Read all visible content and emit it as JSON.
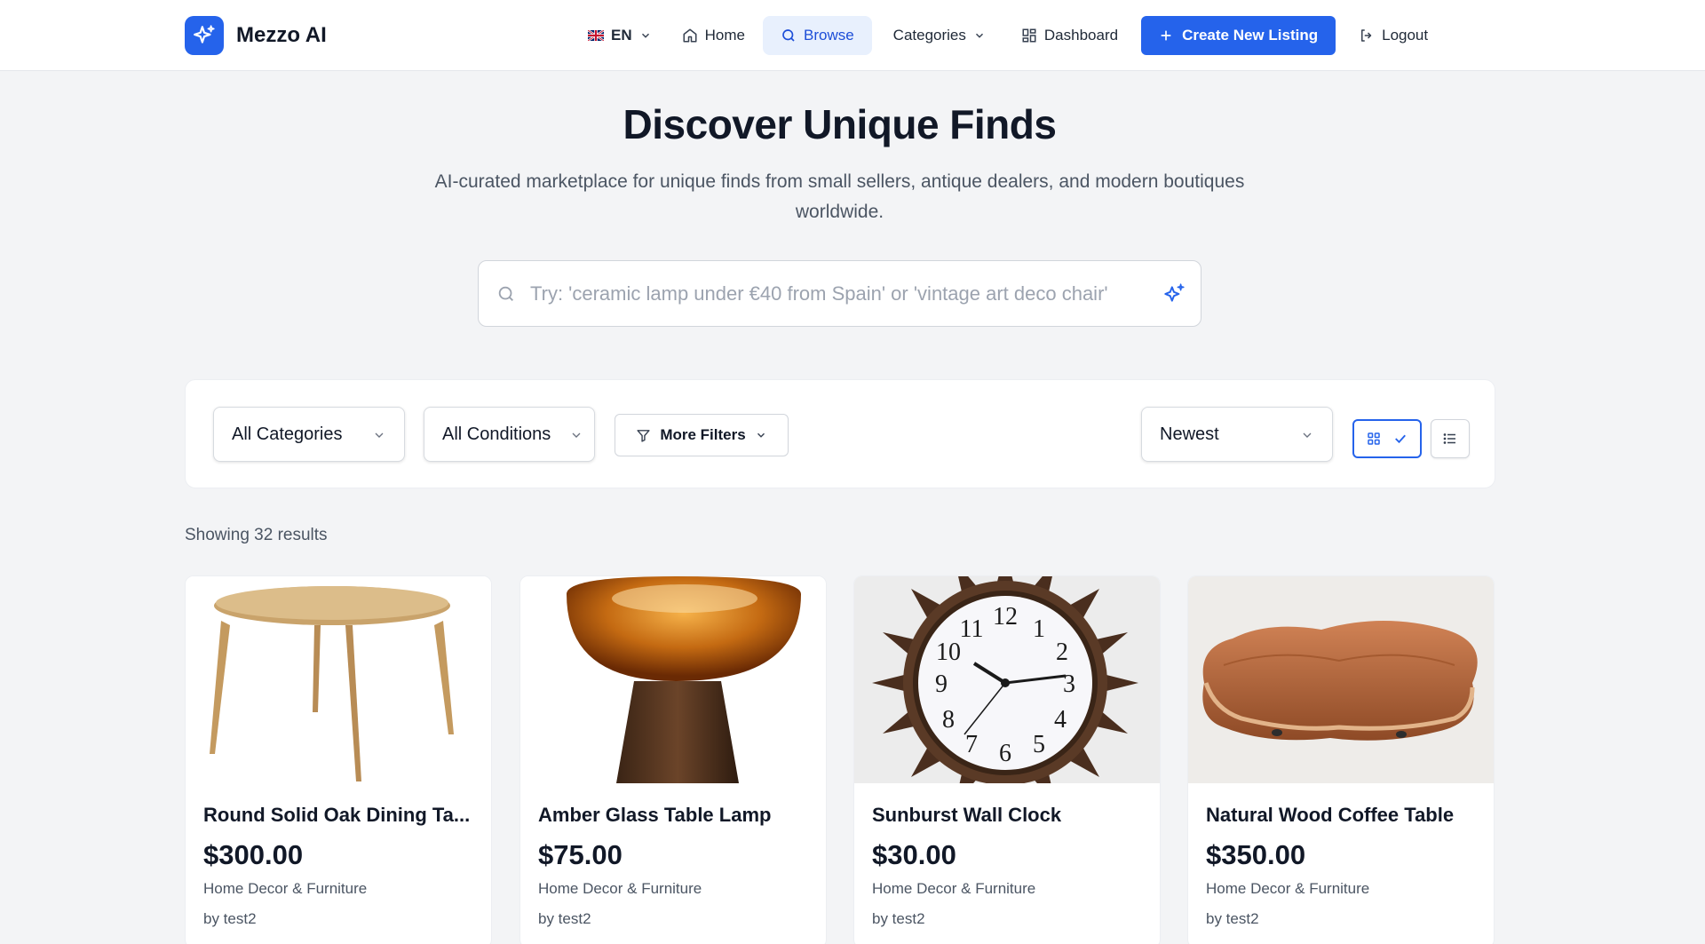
{
  "header": {
    "brand_name": "Mezzo AI",
    "language": "EN",
    "nav": {
      "home": "Home",
      "browse": "Browse",
      "categories": "Categories",
      "dashboard": "Dashboard",
      "create": "Create New Listing",
      "logout": "Logout"
    }
  },
  "hero": {
    "title": "Discover Unique Finds",
    "subtitle": "AI-curated marketplace for unique finds from small sellers, antique dealers, and modern boutiques worldwide.",
    "search_placeholder": "Try: 'ceramic lamp under €40 from Spain' or 'vintage art deco chair'"
  },
  "filters": {
    "category": "All Categories",
    "condition": "All Conditions",
    "more": "More Filters",
    "sort": "Newest"
  },
  "results_text": "Showing 32 results",
  "listings": [
    {
      "title": "Round Solid Oak Dining Ta...",
      "price": "$300.00",
      "category": "Home Decor & Furniture",
      "seller": "by test2"
    },
    {
      "title": "Amber Glass Table Lamp",
      "price": "$75.00",
      "category": "Home Decor & Furniture",
      "seller": "by test2"
    },
    {
      "title": "Sunburst Wall Clock",
      "price": "$30.00",
      "category": "Home Decor & Furniture",
      "seller": "by test2"
    },
    {
      "title": "Natural Wood Coffee Table",
      "price": "$350.00",
      "category": "Home Decor & Furniture",
      "seller": "by test2"
    }
  ],
  "colors": {
    "accent": "#2563eb",
    "page_bg": "#f3f4f6"
  }
}
